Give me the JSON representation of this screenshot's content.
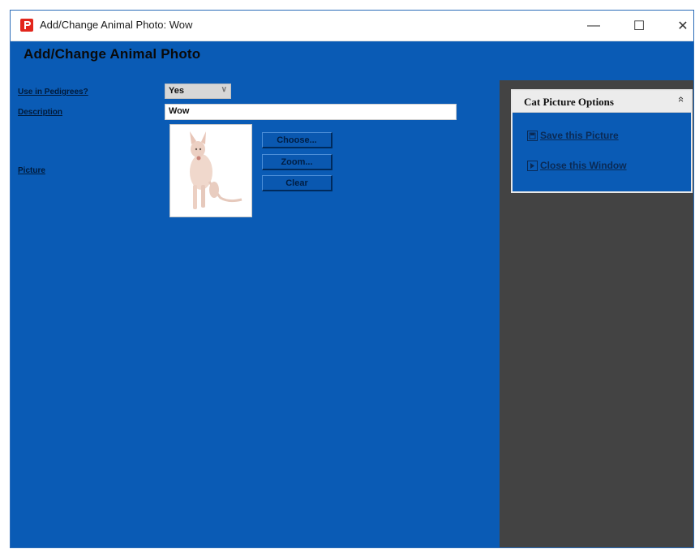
{
  "window": {
    "title": "Add/Change Animal Photo: Wow",
    "minimize_glyph": "—",
    "maximize_glyph": "☐",
    "close_glyph": "✕"
  },
  "form": {
    "title": "Add/Change Animal Photo",
    "use_in_pedigrees_label": "Use in Pedigrees?",
    "use_in_pedigrees_value": "Yes",
    "description_label": "Description",
    "description_value": "Wow",
    "picture_label": "Picture",
    "buttons": {
      "choose": "Choose...",
      "zoom": "Zoom...",
      "clear": "Clear"
    }
  },
  "options_panel": {
    "title": "Cat Picture Options",
    "collapse_glyph": "«",
    "items": [
      {
        "label": "Save this Picture",
        "icon": "save-icon"
      },
      {
        "label": "Close this Window",
        "icon": "close-window-icon"
      }
    ]
  },
  "colors": {
    "form_background": "#0a5bb5",
    "side_panel": "#434343",
    "app_icon": "#e2261c"
  }
}
